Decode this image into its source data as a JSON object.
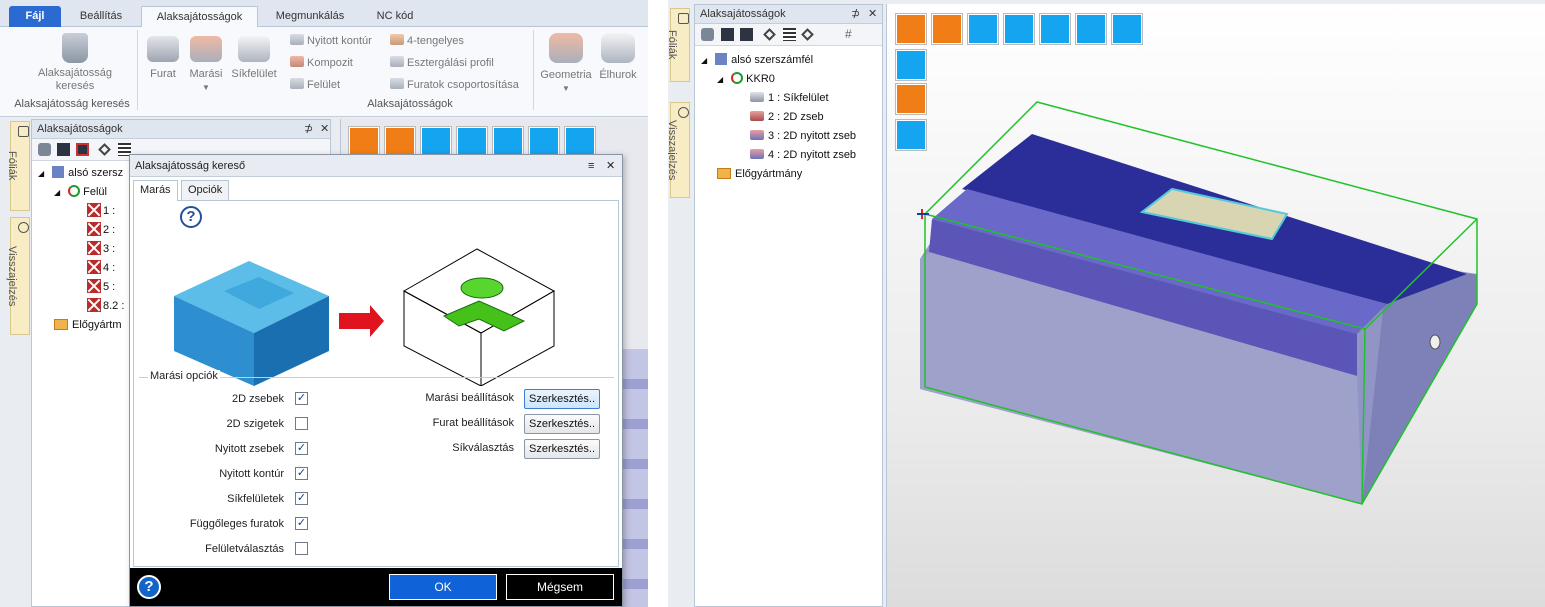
{
  "ribbon": {
    "tabs": [
      "Fájl",
      "Beállítás",
      "Alaksajátosságok",
      "Megmunkálás",
      "NC kód"
    ],
    "active_tab": "Alaksajátosságok",
    "search_button_line1": "Alaksajátosság",
    "search_button_line2": "keresés",
    "search_group_label": "Alaksajátosság keresés",
    "furat": "Furat",
    "marasi": "Marási",
    "sikfelulet": "Síkfelület",
    "nyitott_kontur": "Nyitott kontúr",
    "kompozit": "Kompozit",
    "felulet": "Felület",
    "tengelyes": "4-tengelyes",
    "esztergalasi": "Esztergálási profil",
    "furatok_csop": "Furatok csoportosítása",
    "features_group_label": "Alaksajátosságok",
    "geometria": "Geometria",
    "elhurok": "Élhurok"
  },
  "side_tabs": {
    "foliak": "Fóliák",
    "visszajelzes": "Visszajelzés"
  },
  "left_panel": {
    "title": "Alaksajátosságok",
    "pin": "⊅",
    "close": "✕",
    "tree_root": "alsó szersz",
    "tree_child": "Felül",
    "items": [
      "1 : ",
      "2 : ",
      "3 : ",
      "4 : ",
      "5 : ",
      "8.2 : "
    ],
    "elogyartmany": "Előgyártm"
  },
  "dialog": {
    "title": "Alaksajátosság kereső",
    "close": "✕",
    "tab_maras": "Marás",
    "tab_opciok": "Opciók",
    "group_label": "Marási opciók",
    "options": [
      {
        "label": "2D zsebek",
        "checked": true
      },
      {
        "label": "2D szigetek",
        "checked": false
      },
      {
        "label": "Nyitott zsebek",
        "checked": true
      },
      {
        "label": "Nyitott kontúr",
        "checked": true
      },
      {
        "label": "Síkfelületek",
        "checked": true
      },
      {
        "label": "Függőleges furatok",
        "checked": true
      },
      {
        "label": "Felületválasztás",
        "checked": false
      }
    ],
    "settings": [
      {
        "label": "Marási beállítások",
        "button": "Szerkesztés.."
      },
      {
        "label": "Furat beállítások",
        "button": "Szerkesztés.."
      },
      {
        "label": "Síkválasztás",
        "button": "Szerkesztés.."
      }
    ],
    "help": "?",
    "ok": "OK",
    "cancel": "Mégsem"
  },
  "right_panel": {
    "title": "Alaksajátosságok",
    "pin": "⊅",
    "close": "✕",
    "tree_root": "alsó szerszámfél",
    "tree_child": "KKR0",
    "items": [
      {
        "num": "1 :",
        "name": "Síkfelület"
      },
      {
        "num": "2 :",
        "name": "2D zseb"
      },
      {
        "num": "3 :",
        "name": "2D nyitott zseb"
      },
      {
        "num": "4 :",
        "name": "2D nyitott zseb"
      }
    ],
    "elogyartmany": "Előgyártmány"
  },
  "colors": {
    "orange": "#f07d16",
    "blue": "#14a4f0",
    "ribbon_file": "#2a6ad1",
    "ok_button": "#0f62d8",
    "model_top": "#2c2f9c",
    "model_side": "#8f92c4",
    "bbox": "#1fc22a"
  }
}
